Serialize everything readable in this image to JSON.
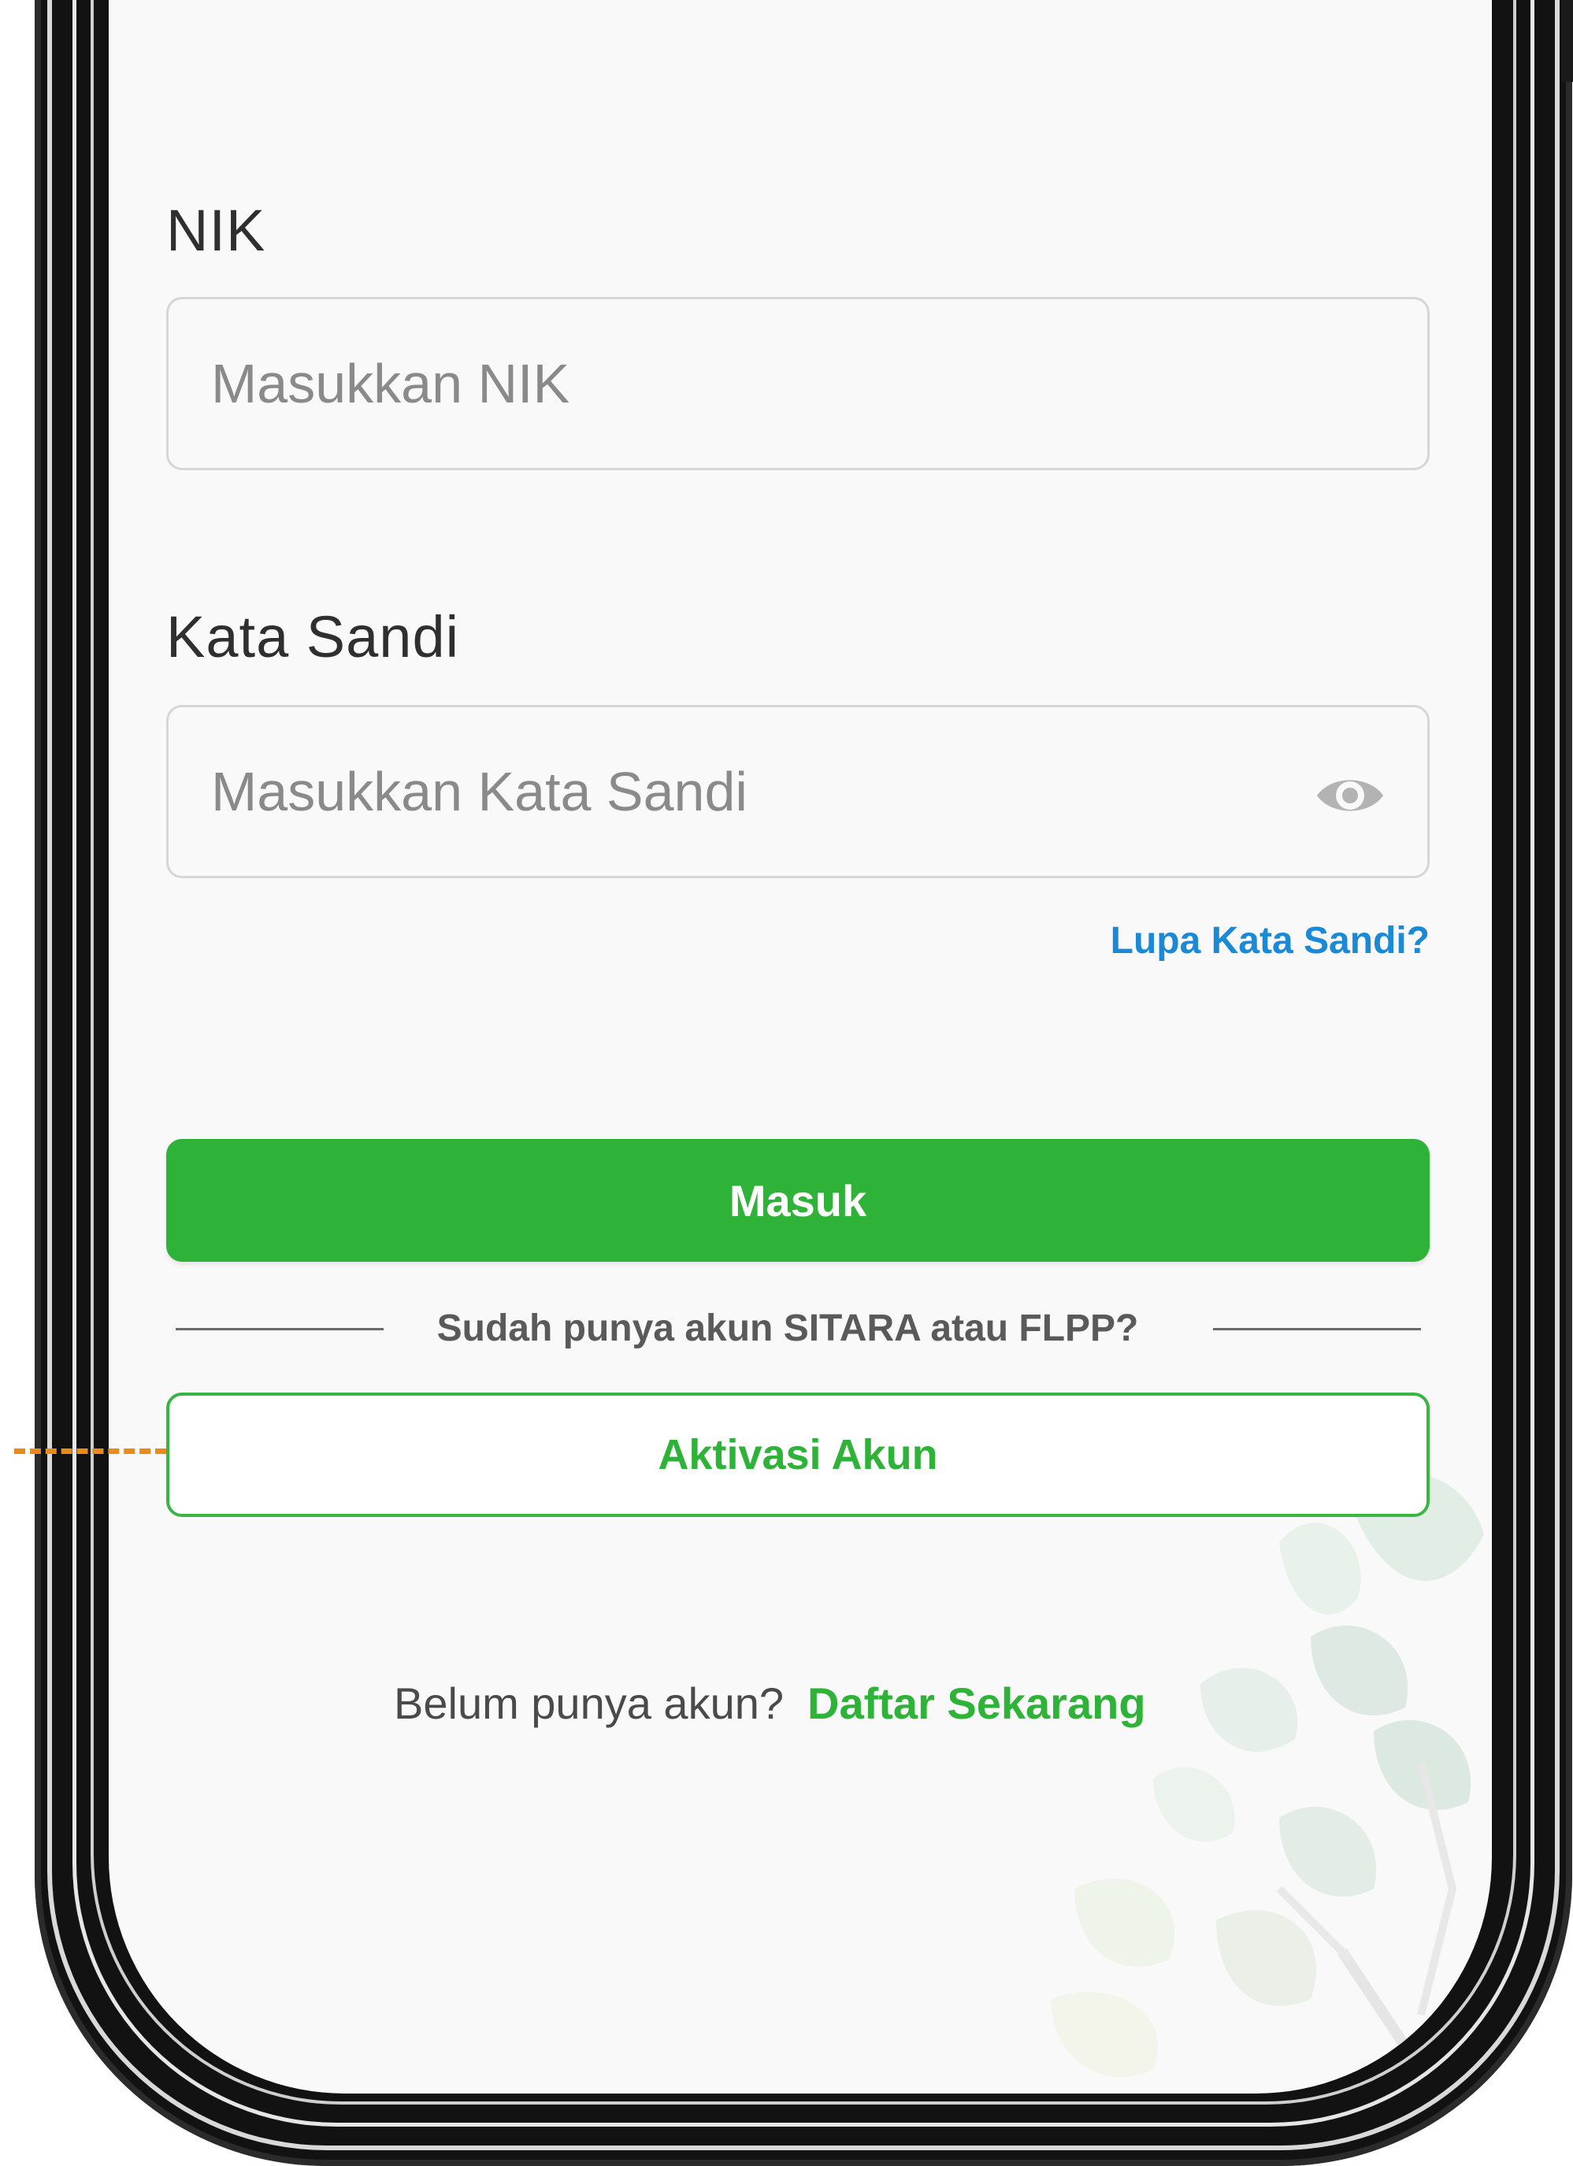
{
  "form": {
    "nik_label": "NIK",
    "nik_placeholder": "Masukkan NIK",
    "password_label": "Kata Sandi",
    "password_placeholder": "Masukkan Kata Sandi",
    "forgot_password": "Lupa Kata Sandi?",
    "login_button": "Masuk",
    "divider_text": "Sudah punya akun SITARA atau FLPP?",
    "activate_button": "Aktivasi Akun",
    "signup_prompt": "Belum punya akun?",
    "signup_link": "Daftar Sekarang"
  },
  "icons": {
    "password_toggle": "eye-icon"
  },
  "colors": {
    "primary_green": "#2fb238",
    "link_blue": "#1a8ad6",
    "callout_orange": "#ea8a1a",
    "screen_bg": "#f9f9f9",
    "frame": "#121212"
  }
}
